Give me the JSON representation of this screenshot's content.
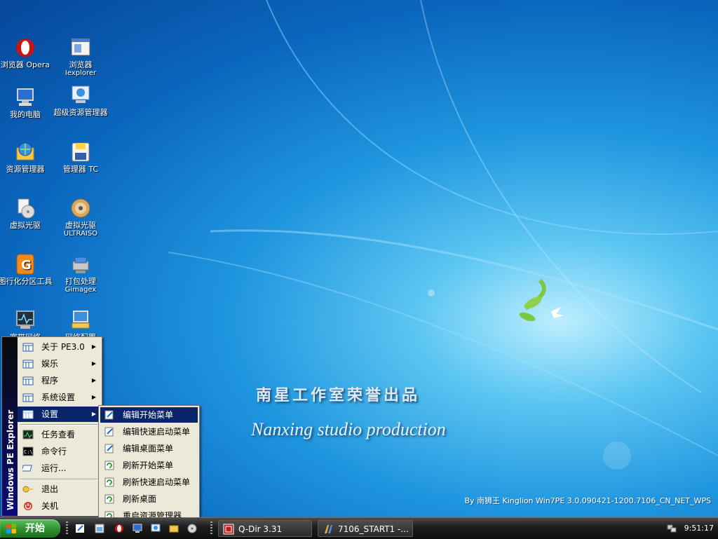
{
  "desktop": {
    "icons": [
      {
        "label": "浏览器 Opera",
        "sub": "",
        "icon": "opera-icon"
      },
      {
        "label": "浏览器",
        "sub": "Iexplorer",
        "icon": "ie-window-icon"
      },
      {
        "label": "我的电脑",
        "sub": "",
        "icon": "computer-icon"
      },
      {
        "label": "超级资源管理器",
        "sub": "",
        "icon": "explorer-icon"
      },
      {
        "label": "资源管理器",
        "sub": "",
        "icon": "globe-folder-icon"
      },
      {
        "label": "管理器 TC",
        "sub": "",
        "icon": "floppy-disk-icon"
      },
      {
        "label": "虚拟光驱",
        "sub": "",
        "icon": "virtual-drive-icon"
      },
      {
        "label": "虚拟光驱",
        "sub": "ULTRAISO",
        "icon": "cd-disc-icon"
      },
      {
        "label": "图行化分区工具",
        "sub": "",
        "icon": "partition-tool-icon"
      },
      {
        "label": "打包处理",
        "sub": "Gimagex",
        "icon": "package-tool-icon"
      },
      {
        "label": "宽带网络",
        "sub": "",
        "icon": "network-monitor-icon"
      },
      {
        "label": "网络配置",
        "sub": "",
        "icon": "network-config-icon"
      }
    ],
    "watermark_cn": "南星工作室荣誉出品",
    "watermark_en": "Nanxing studio production",
    "by_line": "By 南狮王 Kinglion Win7PE 3.0.090421-1200.7106_CN_NET_WPS"
  },
  "start_menu": {
    "banner": "Windows PE Explorer",
    "items": [
      {
        "label": "关于 PE3.0",
        "submenu": true,
        "icon": "folder-grid-icon"
      },
      {
        "label": "娱乐",
        "submenu": true,
        "icon": "folder-grid-icon"
      },
      {
        "label": "程序",
        "submenu": true,
        "icon": "folder-grid-icon"
      },
      {
        "label": "系统设置",
        "submenu": true,
        "icon": "folder-grid-icon"
      },
      {
        "label": "设置",
        "submenu": true,
        "icon": "folder-grid-icon"
      },
      {
        "label": "任务查看",
        "submenu": false,
        "icon": "task-manager-icon"
      },
      {
        "label": "命令行",
        "submenu": false,
        "icon": "command-prompt-icon"
      },
      {
        "label": "运行...",
        "submenu": false,
        "icon": "run-icon"
      },
      {
        "label": "退出",
        "submenu": false,
        "icon": "key-icon"
      },
      {
        "label": "关机",
        "submenu": false,
        "icon": "power-icon"
      }
    ],
    "arrow": "▶"
  },
  "settings_submenu": {
    "items": [
      {
        "label": "编辑开始菜单",
        "icon": "edit-icon"
      },
      {
        "label": "编辑快速启动菜单",
        "icon": "edit-icon"
      },
      {
        "label": "编辑桌面菜单",
        "icon": "edit-icon"
      },
      {
        "label": "刷新开始菜单",
        "icon": "refresh-icon"
      },
      {
        "label": "刷新快速启动菜单",
        "icon": "refresh-icon"
      },
      {
        "label": "刷新桌面",
        "icon": "refresh-icon"
      },
      {
        "label": "重启资源管理器",
        "icon": "refresh-icon"
      }
    ]
  },
  "taskbar": {
    "start_label": "开始",
    "tasks": [
      {
        "label": "Q-Dir 3.31",
        "icon": "qdir-icon"
      },
      {
        "label": "7106_START1 -...",
        "icon": "start-script-icon"
      }
    ],
    "clock": "9:51:17"
  },
  "colors": {
    "menu_highlight": "#0a246a",
    "menu_bg": "#ece9d8",
    "start_green": "#2f8f2f"
  }
}
